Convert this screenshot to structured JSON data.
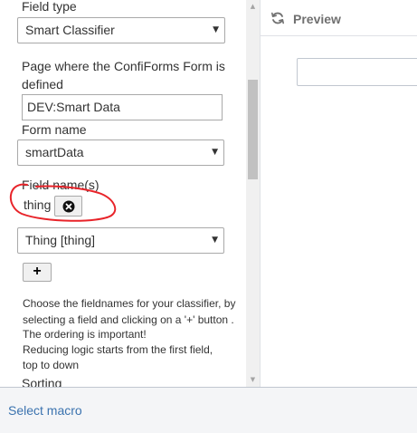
{
  "form": {
    "field_type_label": "Field type",
    "field_type_value": "Smart Classifier",
    "page_label_line1": "Page where the ConfiForms Form is",
    "page_label_line2": "defined",
    "page_value": "DEV:Smart Data",
    "form_name_label": "Form name",
    "form_name_value": "smartData",
    "field_names_label": "Field name(s)",
    "field_chip": "thing",
    "field_select_value": "Thing [thing]",
    "add_button_label": "+",
    "help_lines": [
      "Choose the fieldnames for your classifier, by",
      "selecting a field and clicking on a '+' button .",
      "The ordering is important!",
      "Reducing logic starts from the first field,",
      "top to down"
    ],
    "sorting_label": "Sorting"
  },
  "preview": {
    "title": "Preview"
  },
  "footer": {
    "select_macro": "Select macro"
  },
  "colors": {
    "annotation": "#e8242a",
    "link": "#3b73af"
  }
}
